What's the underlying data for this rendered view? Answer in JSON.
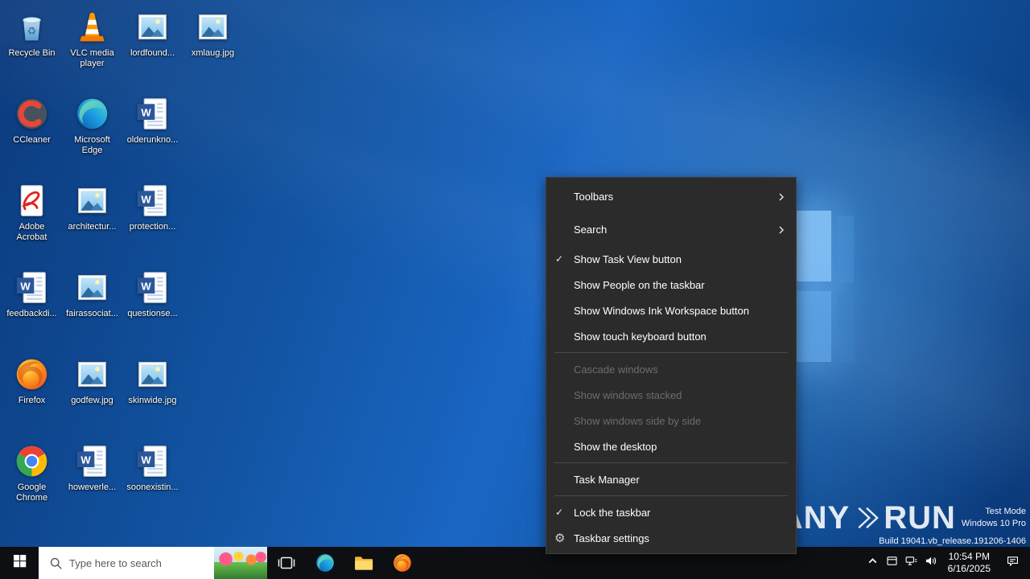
{
  "colors": {
    "accent": "#0078d7",
    "menu_bg": "#2b2b2b",
    "menu_text": "#ffffff",
    "menu_disabled": "#6d6d6d",
    "taskbar_bg": "#0d0f12",
    "search_box_bg": "#ffffff",
    "wallpaper_base": "#1a66c4"
  },
  "desktop": {
    "icons": [
      {
        "label": "Recycle Bin",
        "type": "recycle-bin"
      },
      {
        "label": "CCleaner",
        "type": "ccleaner"
      },
      {
        "label": "Adobe Acrobat",
        "type": "acrobat"
      },
      {
        "label": "feedbackdi...",
        "type": "word"
      },
      {
        "label": "Firefox",
        "type": "firefox"
      },
      {
        "label": "Google Chrome",
        "type": "chrome"
      },
      {
        "label": "VLC media player",
        "type": "vlc"
      },
      {
        "label": "Microsoft Edge",
        "type": "edge"
      },
      {
        "label": "architectur...",
        "type": "image"
      },
      {
        "label": "fairassociat...",
        "type": "image"
      },
      {
        "label": "godfew.jpg",
        "type": "image"
      },
      {
        "label": "howeverle...",
        "type": "word"
      },
      {
        "label": "lordfound...",
        "type": "image"
      },
      {
        "label": "olderunkno...",
        "type": "word"
      },
      {
        "label": "protection...",
        "type": "word"
      },
      {
        "label": "questionse...",
        "type": "word"
      },
      {
        "label": "skinwide.jpg",
        "type": "image"
      },
      {
        "label": "soonexistin...",
        "type": "word"
      },
      {
        "label": "xmlaug.jpg",
        "type": "image"
      }
    ]
  },
  "context_menu": {
    "items": [
      {
        "label": "Toolbars",
        "type": "submenu"
      },
      {
        "label": "Search",
        "type": "submenu"
      },
      {
        "label": "Show Task View button",
        "checked": true
      },
      {
        "label": "Show People on the taskbar"
      },
      {
        "label": "Show Windows Ink Workspace button"
      },
      {
        "label": "Show touch keyboard button"
      },
      {
        "type": "separator"
      },
      {
        "label": "Cascade windows",
        "disabled": true
      },
      {
        "label": "Show windows stacked",
        "disabled": true
      },
      {
        "label": "Show windows side by side",
        "disabled": true
      },
      {
        "label": "Show the desktop"
      },
      {
        "type": "separator"
      },
      {
        "label": "Task Manager"
      },
      {
        "type": "separator"
      },
      {
        "label": "Lock the taskbar",
        "checked": true
      },
      {
        "label": "Taskbar settings",
        "icon": "gear"
      }
    ]
  },
  "taskbar": {
    "search": {
      "placeholder": "Type here to search"
    },
    "clock": {
      "time": "10:54 PM",
      "date": "6/16/2025"
    }
  },
  "watermark": {
    "brand_left": "ANY",
    "brand_right": "RUN",
    "mode": "Test Mode",
    "os": "Windows 10 Pro",
    "build": "Build 19041.vb_release.191206-1406"
  }
}
